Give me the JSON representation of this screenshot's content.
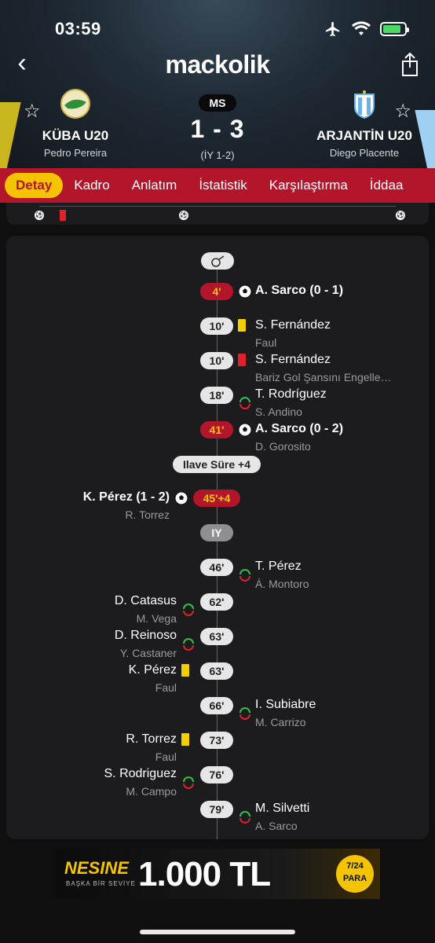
{
  "status_bar": {
    "time": "03:59"
  },
  "app": {
    "logo": "mackolik"
  },
  "match": {
    "status": "MS",
    "score": "1 - 3",
    "half_time": "(İY 1-2)",
    "home": {
      "name": "KÜBA U20",
      "coach": "Pedro Pereira"
    },
    "away": {
      "name": "ARJANTİN U20",
      "coach": "Diego Placente"
    }
  },
  "tabs": [
    "Detay",
    "Kadro",
    "Anlatım",
    "İstatistik",
    "Karşılaştırma",
    "İddaa"
  ],
  "events": [
    {
      "id": "e1",
      "minute": "4'",
      "side": "right",
      "type": "goal",
      "player": "A. Sarco (0 - 1)",
      "sub": ""
    },
    {
      "id": "e2",
      "minute": "10'",
      "side": "right",
      "type": "yellow",
      "player": "S. Fernández",
      "sub": "Faul"
    },
    {
      "id": "e3",
      "minute": "10'",
      "side": "right",
      "type": "red",
      "player": "S. Fernández",
      "sub": "Bariz Gol Şansını Engelle…"
    },
    {
      "id": "e4",
      "minute": "18'",
      "side": "right",
      "type": "subst",
      "player": "T. Rodríguez",
      "sub": "S. Andino"
    },
    {
      "id": "e5",
      "minute": "41'",
      "side": "right",
      "type": "goal",
      "player": "A. Sarco (0 - 2)",
      "sub": "D. Gorosito"
    },
    {
      "id": "e6",
      "minute": "45'+4",
      "side": "left",
      "type": "goal",
      "player": "K. Pérez (1 - 2)",
      "sub": "R. Torrez"
    },
    {
      "id": "e7",
      "minute": "46'",
      "side": "right",
      "type": "subst",
      "player": "T. Pérez",
      "sub": "Á. Montoro"
    },
    {
      "id": "e8",
      "minute": "62'",
      "side": "left",
      "type": "subst",
      "player": "D. Catasus",
      "sub": "M. Vega"
    },
    {
      "id": "e9",
      "minute": "63'",
      "side": "left",
      "type": "subst",
      "player": "D. Reinoso",
      "sub": "Y. Castaner"
    },
    {
      "id": "e10",
      "minute": "63'",
      "side": "left",
      "type": "yellow",
      "player": "K. Pérez",
      "sub": "Faul"
    },
    {
      "id": "e11",
      "minute": "66'",
      "side": "right",
      "type": "subst",
      "player": "I. Subiabre",
      "sub": "M. Carrizo"
    },
    {
      "id": "e12",
      "minute": "73'",
      "side": "left",
      "type": "yellow",
      "player": "R. Torrez",
      "sub": "Faul"
    },
    {
      "id": "e13",
      "minute": "76'",
      "side": "left",
      "type": "subst",
      "player": "S. Rodriguez",
      "sub": "M. Campo"
    },
    {
      "id": "e14",
      "minute": "79'",
      "side": "right",
      "type": "subst",
      "player": "M. Silvetti",
      "sub": "A. Sarco"
    }
  ],
  "markers": {
    "added_time": "Ilave Süre +4",
    "half_time": "IY"
  },
  "ad": {
    "brand": "NESINE",
    "tagline": "BAŞKA BİR SEVİYE",
    "amount": "1.000 TL",
    "badge_line1": "7/24",
    "badge_line2": "PARA"
  },
  "colors": {
    "accent_red": "#b3152a",
    "accent_yellow": "#f5c400",
    "card_bg": "#1c1c1e"
  }
}
